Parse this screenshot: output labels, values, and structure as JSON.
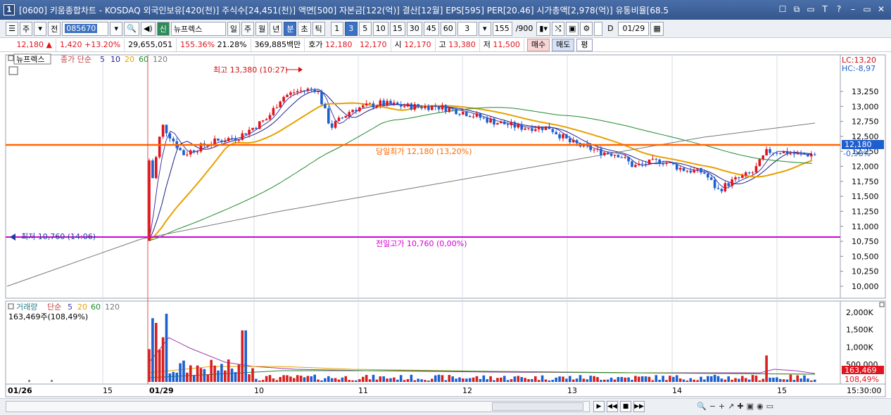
{
  "window": {
    "number_badge": "1",
    "title": "[0600] 키움종합차트 - KOSDAQ 외국인보유[420(천)] 주식수[24,451(천)] 액면[500] 자본금[122(억)] 결산[12월] EPS[595] PER[20.46] 시가총액[2,978(억)] 유통비율[68.5",
    "controls": [
      "☐",
      "⧉",
      "▭",
      "T",
      "?",
      "–",
      "▭",
      "✕"
    ]
  },
  "toolbar": {
    "period_main": "주",
    "prev_label": "전",
    "stock_code": "085670",
    "stock_name": "뉴프렉스",
    "stock_prefix": "신",
    "periods": [
      "일",
      "주",
      "월",
      "년"
    ],
    "active_period": "분",
    "sub_periods": [
      "분",
      "초",
      "틱"
    ],
    "minute_options": [
      "1",
      "3",
      "5",
      "10",
      "15",
      "30",
      "45",
      "60"
    ],
    "active_minute": "3",
    "minute_select": "3",
    "count": "155",
    "count_total": "/900",
    "d_checkbox_label": "D",
    "date_value": "01/29"
  },
  "quote": {
    "price": "12,180",
    "arrow": "▲",
    "change": "1,420",
    "change_pct": "+13.20%",
    "volume": "29,655,051",
    "volume_ratio": "155.36%",
    "turnover": "21.28%",
    "trade_value": "369,885백만",
    "bid_label": "호가",
    "ask_price": "12,180",
    "bid_price": "12,170",
    "open_label": "시",
    "open_price": "12,170",
    "high_label": "고",
    "high_price": "13,380",
    "low_label": "저",
    "low_price": "11,500",
    "buy_button": "매수",
    "sell_button": "매도",
    "eval_button": "평"
  },
  "price_panel": {
    "legend_name": "뉴프렉스",
    "legend_type": "종가 단순",
    "ma_periods": [
      "5",
      "10",
      "20",
      "60",
      "120"
    ],
    "ma_colors": [
      "#3a3aa8",
      "#1c1c88",
      "#e8a000",
      "#1f8a2e",
      "#777777"
    ],
    "high_annotation": "최고 13,380 (10:27)",
    "low_annotation": "최저 10,760 (14:06)",
    "today_ratio_annotation": "당일최가 12,180 (13,20%)",
    "prev_close_annotation": "전일고가 10,760 (0,00%)",
    "lc_label": "LC:13,20",
    "hc_label": "HC:-8,97",
    "current_price_tag": "12,180",
    "current_pct_tag": "-0,98%",
    "y_ticks": [
      "13,250",
      "13,000",
      "12,750",
      "12,500",
      "12,250",
      "12,000",
      "11,750",
      "11,500",
      "11,250",
      "11,000",
      "10,750",
      "10,500",
      "10,250",
      "10,000"
    ]
  },
  "volume_panel": {
    "legend_name": "거래량",
    "legend_type": "단순",
    "ma_periods": [
      "5",
      "20",
      "60",
      "120"
    ],
    "summary": "163,469주(108,49%)",
    "y_ticks": [
      "2,000K",
      "1,500K",
      "1,000K",
      "500,000"
    ],
    "current_tag": "163,469",
    "pct_tag": "108,49%"
  },
  "x_axis": {
    "labels": [
      "01/26",
      "15",
      "01/29",
      "10",
      "11",
      "12",
      "13",
      "14",
      "15",
      "15:30:00"
    ]
  },
  "colors": {
    "up": "#e0141e",
    "down": "#1e5fd0",
    "title_bar": "#3e6199",
    "current_line": "#ff6600",
    "prev_line": "#d400d4"
  }
}
